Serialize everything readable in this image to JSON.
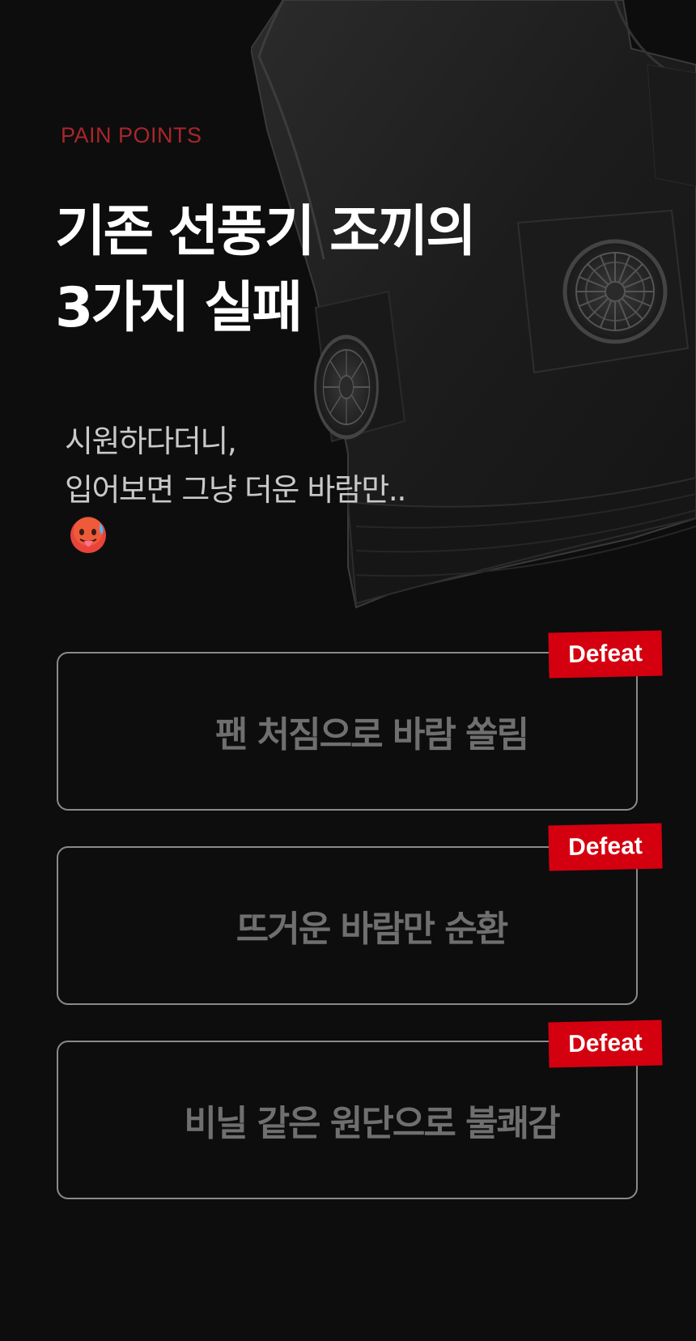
{
  "section": {
    "eyebrow": "PAIN POINTS",
    "headline_line1": "기존 선풍기 조끼의",
    "headline_line2": "3가지 실패",
    "subcopy_line1": "시원하다더니,",
    "subcopy_line2": "입어보면 그냥 더운 바람만.."
  },
  "pain_points": [
    {
      "text": "팬 처짐으로 바람 쏠림",
      "badge": "Defeat"
    },
    {
      "text": "뜨거운 바람만 순환",
      "badge": "Defeat"
    },
    {
      "text": "비닐 같은 원단으로 불쾌감",
      "badge": "Defeat"
    }
  ],
  "icons": {
    "emoji": "hot-face-emoji-icon",
    "vest": "fan-vest-illustration"
  },
  "colors": {
    "background": "#0d0d0d",
    "eyebrow": "#a8262c",
    "badge": "#d4000f",
    "card_border": "#8a8a8a",
    "card_text": "#6f6f6f"
  }
}
